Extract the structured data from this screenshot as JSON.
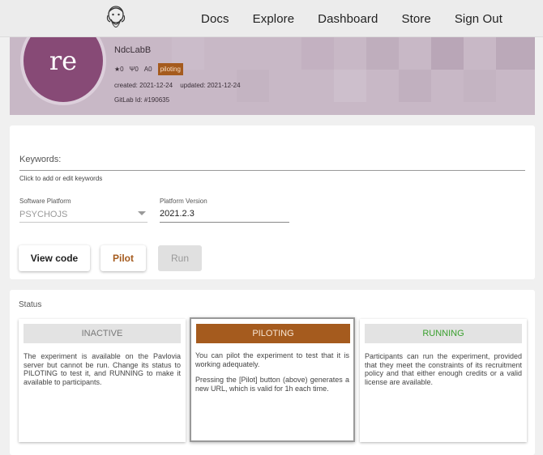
{
  "nav": {
    "logo_icon": "pavlovia-logo-icon",
    "links": [
      "Docs",
      "Explore",
      "Dashboard",
      "Store",
      "Sign Out"
    ]
  },
  "project": {
    "avatar_text": "re",
    "name": "NdcLabB",
    "stars": "0",
    "forks": "0",
    "watchers": "0",
    "status_badge": "piloting",
    "created": "created: 2021-12-24",
    "updated": "updated: 2021-12-24",
    "gitlab_id": "GitLab Id: #190635",
    "colors": {
      "avatar": "#874a76",
      "banner": "#c8b8c6",
      "piloting": "#a55b1e"
    }
  },
  "settings": {
    "keywords_label": "Keywords:",
    "keywords_hint": "Click to add or edit keywords",
    "software_platform_label": "Software Platform",
    "software_platform_value": "PSYCHOJS",
    "platform_version_label": "Platform Version",
    "platform_version_value": "2021.2.3",
    "buttons": {
      "view_code": "View code",
      "pilot": "Pilot",
      "run": "Run"
    }
  },
  "status": {
    "label": "Status",
    "cards": [
      {
        "title": "INACTIVE",
        "description": "The experiment is available on the Pavlovia server but cannot be run. Change its status to PILOTING to test it, and RUNNING to make it available to participants."
      },
      {
        "title": "PILOTING",
        "description_1": "You can pilot the experiment to test that it is working adequately.",
        "description_2": "Pressing the [Pilot] button (above) generates a new URL, which is valid for 1h each time."
      },
      {
        "title": "RUNNING",
        "description": "Participants can run the experiment, provided that they meet the constraints of its recruitment policy and that either enough credits or a valid license are available."
      }
    ]
  }
}
